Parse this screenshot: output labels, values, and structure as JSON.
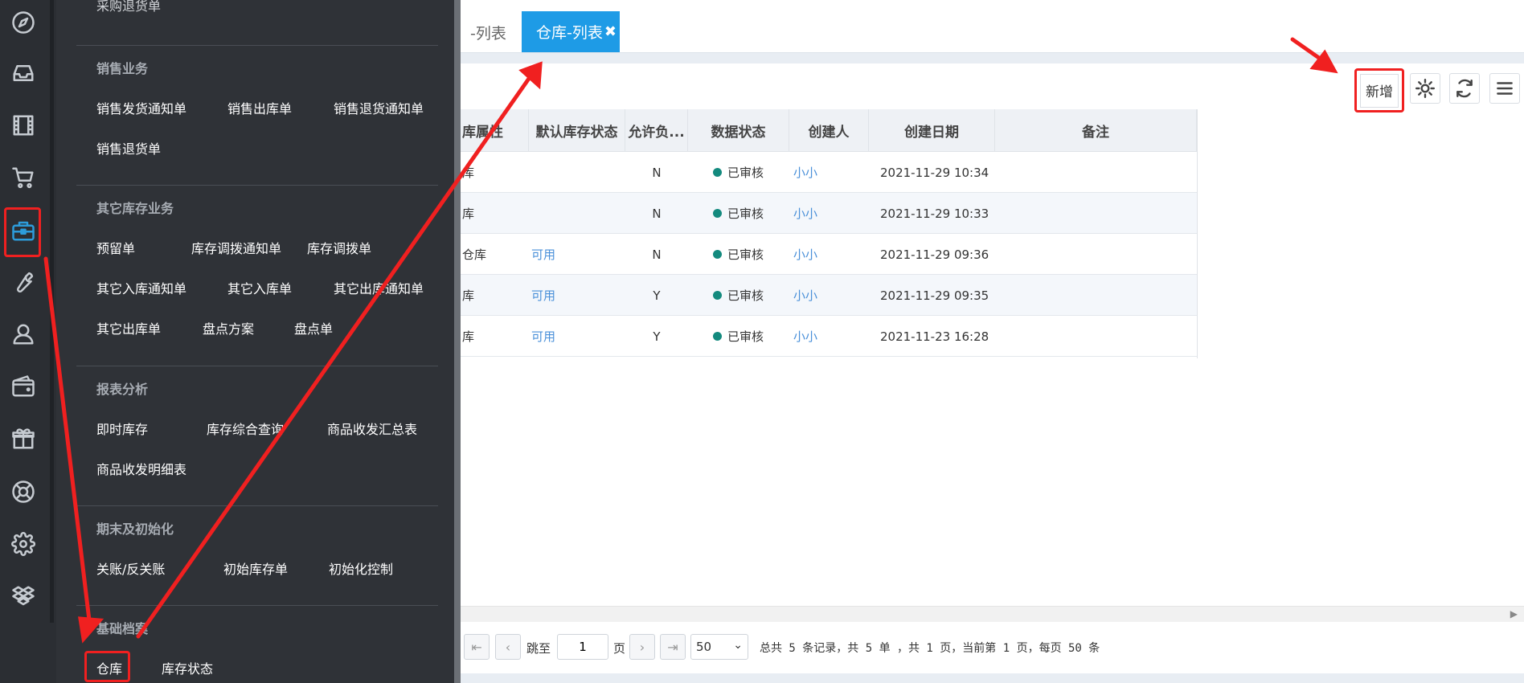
{
  "sidebar": {
    "icons": [
      "compass-icon",
      "inbox-icon",
      "film-icon",
      "cart-icon",
      "briefcase-icon",
      "wrench-icon",
      "user-icon",
      "wallet-icon",
      "gift-icon",
      "lifebuoy-icon",
      "gear-icon",
      "dropbox-icon"
    ]
  },
  "menu": {
    "top_item": "采购退货单",
    "sections": [
      {
        "title": "销售业务",
        "items": [
          "销售发货通知单",
          "销售出库单",
          "销售退货通知单",
          "销售退货单"
        ]
      },
      {
        "title": "其它库存业务",
        "items": [
          "预留单",
          "库存调拨通知单",
          "库存调拨单",
          "其它入库通知单",
          "其它入库单",
          "其它出库通知单",
          "其它出库单",
          "盘点方案",
          "盘点单"
        ]
      },
      {
        "title": "报表分析",
        "items": [
          "即时库存",
          "库存综合查询",
          "商品收发汇总表",
          "商品收发明细表"
        ]
      },
      {
        "title": "期末及初始化",
        "items": [
          "关账/反关账",
          "初始库存单",
          "初始化控制"
        ]
      },
      {
        "title": "基础档案",
        "items": [
          "仓库",
          "库存状态"
        ]
      }
    ]
  },
  "tabs": {
    "prev_label": "-列表",
    "active_label": "仓库-列表",
    "close_glyph": "✖"
  },
  "toolbar": {
    "add_label": "新增"
  },
  "table": {
    "headers": [
      "库属性",
      "默认库存状态",
      "允许负...",
      "数据状态",
      "创建人",
      "创建日期",
      "备注"
    ],
    "rows": [
      {
        "attr": "库",
        "status": "",
        "neg": "N",
        "data_status": "已审核",
        "creator": "小小",
        "date": "2021-11-29 10:34",
        "note": ""
      },
      {
        "attr": "库",
        "status": "",
        "neg": "N",
        "data_status": "已审核",
        "creator": "小小",
        "date": "2021-11-29 10:33",
        "note": ""
      },
      {
        "attr": "仓库",
        "status": "可用",
        "neg": "N",
        "data_status": "已审核",
        "creator": "小小",
        "date": "2021-11-29 09:36",
        "note": ""
      },
      {
        "attr": "库",
        "status": "可用",
        "neg": "Y",
        "data_status": "已审核",
        "creator": "小小",
        "date": "2021-11-29 09:35",
        "note": ""
      },
      {
        "attr": "库",
        "status": "可用",
        "neg": "Y",
        "data_status": "已审核",
        "creator": "小小",
        "date": "2021-11-23 16:28",
        "note": ""
      }
    ]
  },
  "pager": {
    "jump_label": "跳至",
    "page_value": "1",
    "page_unit": "页",
    "page_size": "50",
    "summary": "总共 5 条记录，共 5 单 ，共 1 页，当前第 1 页，每页 50 条"
  },
  "colors": {
    "accent": "#1e9be6",
    "annotation": "#f02020",
    "status_dot": "#138a7e"
  }
}
